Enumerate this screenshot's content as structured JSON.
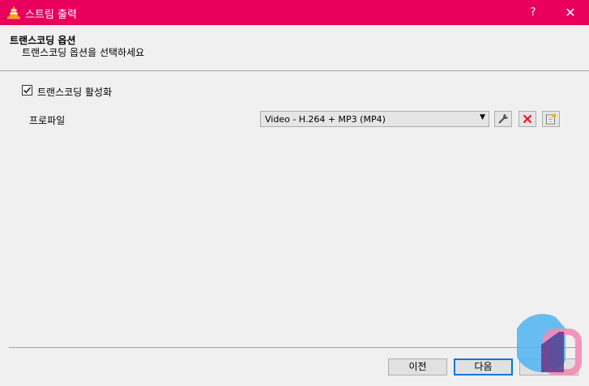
{
  "window": {
    "title": "스트림 출력",
    "help": "?",
    "close": "✕"
  },
  "header": {
    "title": "트랜스코딩 옵션",
    "subtitle": "트랜스코딩 옵션을 선택하세요"
  },
  "transcode": {
    "checkbox_label": "트랜스코딩 활성화",
    "checked": true
  },
  "profile": {
    "label": "프로파일",
    "selected": "Video - H.264 + MP3 (MP4)"
  },
  "buttons": {
    "back": "이전",
    "next": "다음"
  },
  "colors": {
    "titlebar": "#e8005c",
    "delete_icon": "#e81123",
    "focus": "#0078d7"
  }
}
